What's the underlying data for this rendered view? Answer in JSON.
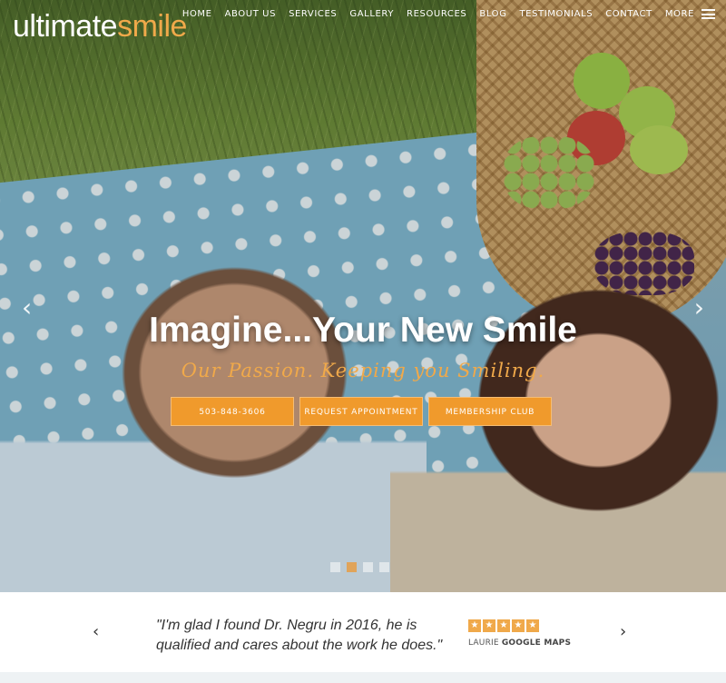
{
  "brand": {
    "logo_part1": "ultimate",
    "logo_part2": "smile",
    "accent": "#f0a94a"
  },
  "nav": {
    "items": [
      "HOME",
      "ABOUT US",
      "SERVICES",
      "GALLERY",
      "RESOURCES",
      "BLOG",
      "TESTIMONIALS",
      "CONTACT",
      "MORE"
    ],
    "menu_icon": "hamburger-icon"
  },
  "hero": {
    "headline": "Imagine...Your New Smile",
    "tagline": "Our Passion. Keeping you Smiling.",
    "prev_icon": "chevron-left-icon",
    "next_icon": "chevron-right-icon",
    "cta": [
      "503-848-3606",
      "REQUEST APPOINTMENT",
      "MEMBERSHIP CLUB"
    ],
    "cta_color": "#f09a2c",
    "slides": 4,
    "active_slide": 2
  },
  "testimonial": {
    "quote": "\"I'm glad I found Dr. Negru in 2016, he is qualified and cares about the work he does.\"",
    "rating": 5,
    "reviewer_name": "LAURIE",
    "reviewer_source": "GOOGLE MAPS",
    "prev_icon": "chevron-left-icon",
    "next_icon": "chevron-right-icon"
  }
}
